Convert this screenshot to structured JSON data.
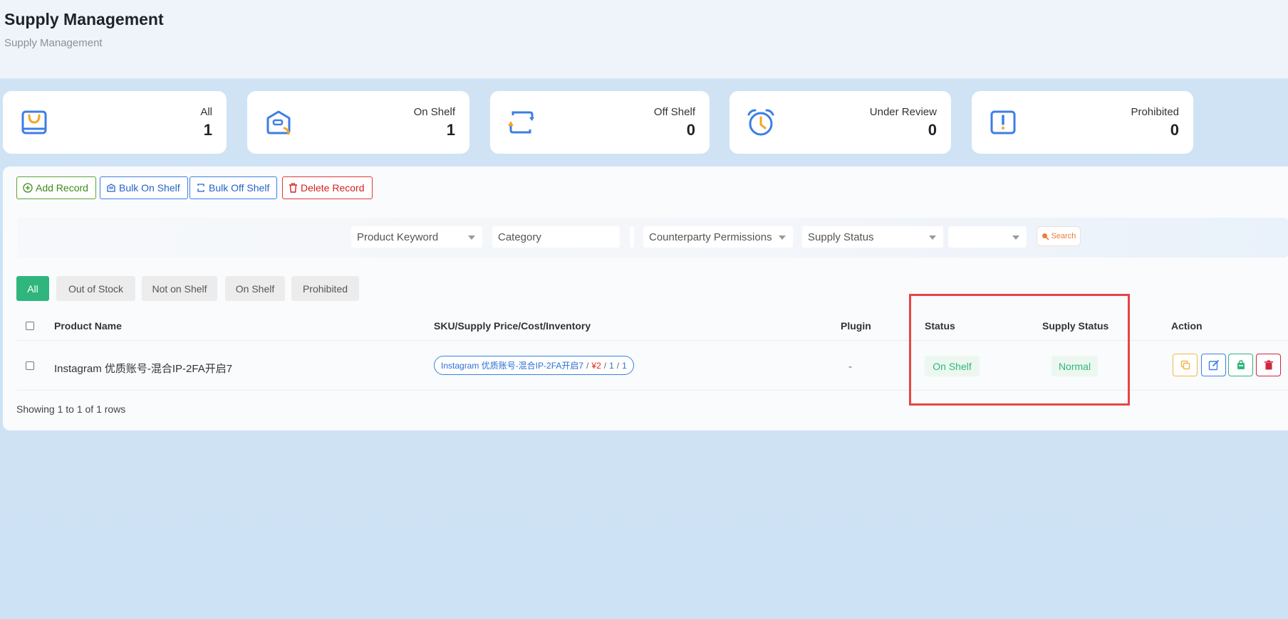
{
  "header": {
    "title": "Supply Management",
    "subtitle": "Supply Management"
  },
  "stats": [
    {
      "label": "All",
      "value": "1",
      "icon": "shopping-bag-icon"
    },
    {
      "label": "On Shelf",
      "value": "1",
      "icon": "box-shelf-icon"
    },
    {
      "label": "Off Shelf",
      "value": "0",
      "icon": "swap-arrows-icon"
    },
    {
      "label": "Under Review",
      "value": "0",
      "icon": "alarm-clock-icon"
    },
    {
      "label": "Prohibited",
      "value": "0",
      "icon": "warning-icon"
    }
  ],
  "toolbar": {
    "add_label": "Add Record",
    "bulk_on_label": "Bulk On Shelf",
    "bulk_off_label": "Bulk Off Shelf",
    "delete_label": "Delete Record"
  },
  "filters": {
    "product_keyword": "Product Keyword",
    "category": "Category",
    "counterparty_permissions": "Counterparty Permissions",
    "supply_status": "Supply Status",
    "extra_select": "",
    "search_label": "Search"
  },
  "tabs": [
    {
      "label": "All",
      "active": true
    },
    {
      "label": "Out of Stock",
      "active": false
    },
    {
      "label": "Not on Shelf",
      "active": false
    },
    {
      "label": "On Shelf",
      "active": false
    },
    {
      "label": "Prohibited",
      "active": false
    }
  ],
  "table": {
    "columns": {
      "product_name": "Product Name",
      "sku": "SKU/Supply Price/Cost/Inventory",
      "plugin": "Plugin",
      "status": "Status",
      "supply_status": "Supply Status",
      "action": "Action"
    },
    "rows": [
      {
        "product_name": "Instagram 优质账号-混合IP-2FA开启7",
        "sku_name": "Instagram 优质账号-混合IP-2FA开启7",
        "sep": "/",
        "supply_price": "¥2",
        "cost": "1",
        "inventory": "1",
        "plugin": "-",
        "status": "On Shelf",
        "supply_status": "Normal"
      }
    ]
  },
  "footer": {
    "pagination_text": "Showing 1 to 1 of 1 rows"
  },
  "colors": {
    "green_accent": "#2fb67c",
    "blue_accent": "#3d7ee6",
    "red_accent": "#e03838",
    "orange_accent": "#f5a623",
    "highlight": "#e84545"
  }
}
